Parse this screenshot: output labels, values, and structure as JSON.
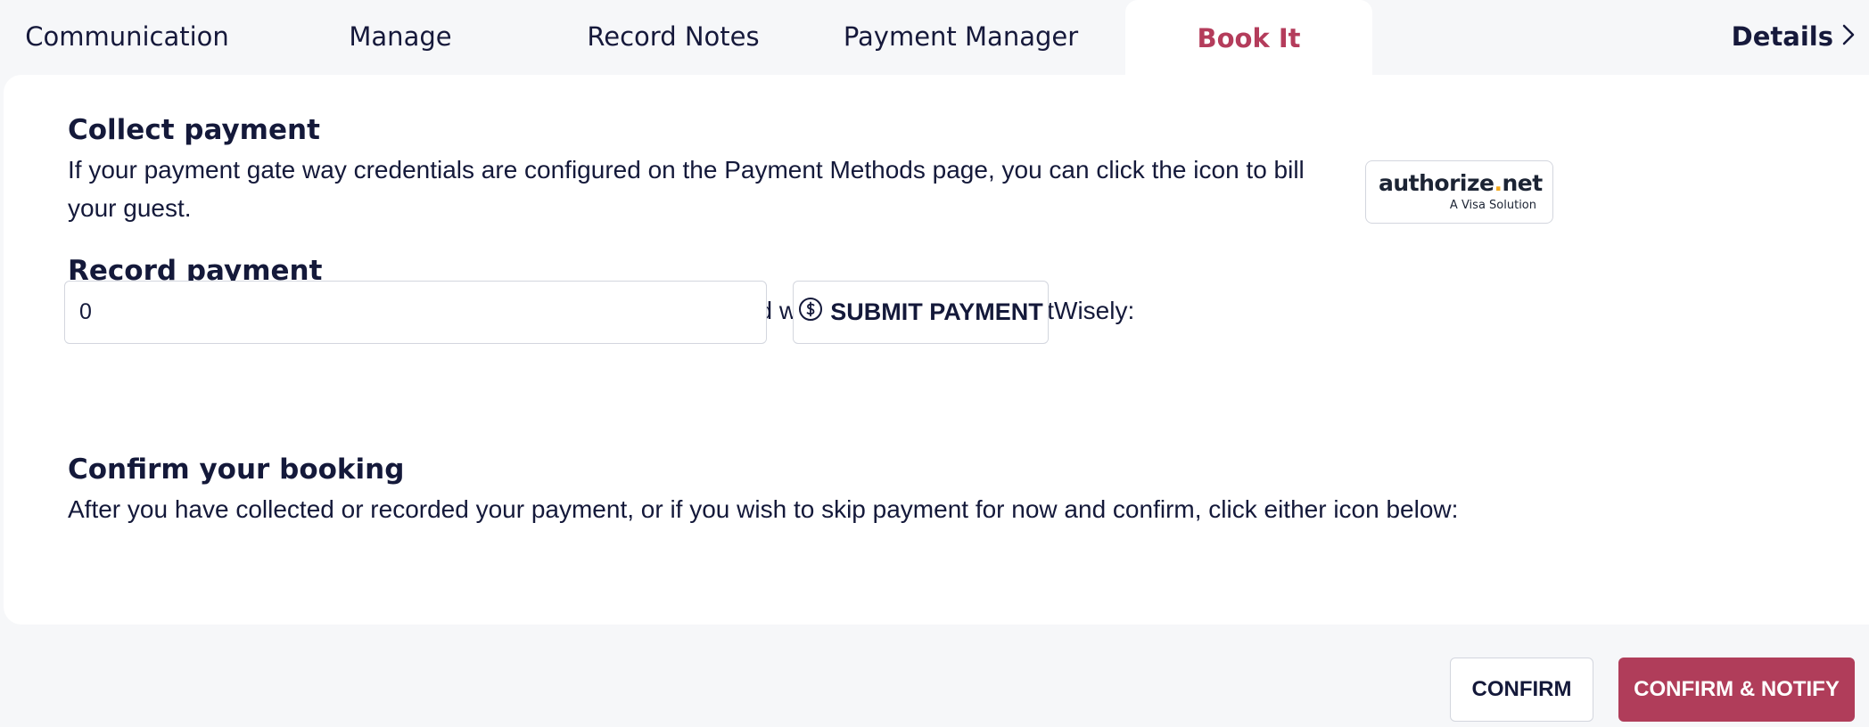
{
  "tabs": [
    {
      "label": "Communication"
    },
    {
      "label": "Manage"
    },
    {
      "label": "Record Notes"
    },
    {
      "label": "Payment Manager"
    },
    {
      "label": "Book It",
      "active": true
    }
  ],
  "details": {
    "label": "Details",
    "icon": "chevron-right-icon"
  },
  "collect": {
    "title": "Collect payment",
    "text": "If your payment gate way credentials are configured on the Payment Methods page, you can click the icon to bill your guest."
  },
  "record": {
    "title": "Record payment",
    "text": "Alternatively, if you have received payment some other way and wish to record it in GuestWisely:",
    "amount_value": "0",
    "submit_label": "SUBMIT PAYMENT",
    "submit_icon": "dollar-circle-icon"
  },
  "gateway": {
    "brand_main": "authorize",
    "brand_dot": ".",
    "brand_tld": "net",
    "tagline": "A Visa Solution"
  },
  "confirm": {
    "title": "Confirm your booking",
    "text": "After you have collected or recorded your payment, or if you wish to skip payment for now and confirm, click either icon below:"
  },
  "actions": {
    "confirm_label": "CONFIRM",
    "confirm_notify_label": "CONFIRM & NOTIFY"
  },
  "colors": {
    "accent": "#b03d5a",
    "text": "#14193a",
    "background": "#f6f7f9"
  }
}
